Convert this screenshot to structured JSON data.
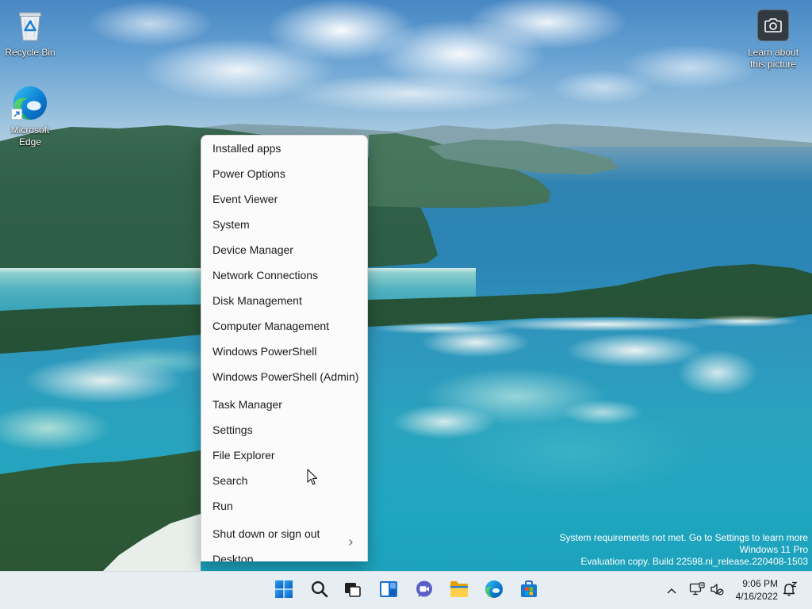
{
  "desktop": {
    "recycle_bin": {
      "label": "Recycle Bin",
      "icon": "recycle-bin-icon"
    },
    "edge": {
      "label": "Microsoft Edge",
      "icon": "edge-icon",
      "badge_icon": "shortcut-arrow-icon"
    },
    "spotlight": {
      "label": "Learn about this picture",
      "icon": "camera-icon"
    }
  },
  "menu": {
    "items": [
      {
        "label": "Installed apps"
      },
      {
        "label": "Power Options"
      },
      {
        "label": "Event Viewer"
      },
      {
        "label": "System"
      },
      {
        "label": "Device Manager"
      },
      {
        "label": "Network Connections"
      },
      {
        "label": "Disk Management"
      },
      {
        "label": "Computer Management"
      },
      {
        "label": "Windows PowerShell"
      },
      {
        "label": "Windows PowerShell (Admin)"
      },
      {
        "label": "Task Manager"
      },
      {
        "label": "Settings"
      },
      {
        "label": "File Explorer"
      },
      {
        "label": "Search"
      },
      {
        "label": "Run"
      },
      {
        "label": "Shut down or sign out",
        "submenu_icon": "chevron-right-icon"
      },
      {
        "label": "Desktop"
      }
    ]
  },
  "watermark": {
    "line1": "System requirements not met. Go to Settings to learn more",
    "line2": "Windows 11 Pro",
    "line3": "Evaluation copy. Build 22598.ni_release.220408-1503"
  },
  "taskbar": {
    "pinned_icons": [
      "windows-start-icon",
      "search-icon",
      "task-view-icon",
      "widgets-icon",
      "chat-icon",
      "file-explorer-icon",
      "edge-icon",
      "microsoft-store-icon"
    ],
    "tray_icons": [
      "chevron-up-icon",
      "network-icon",
      "volume-muted-icon",
      "notification-bell-icon"
    ],
    "clock": {
      "time": "9:06 PM",
      "date": "4/16/2022"
    }
  },
  "colors": {
    "menu_bg": "#fbfbfb",
    "menu_text": "#1b1b1b",
    "taskbar_bg": "#eef1f5",
    "accent": "#0078d4",
    "desktop_text": "#ffffff"
  }
}
